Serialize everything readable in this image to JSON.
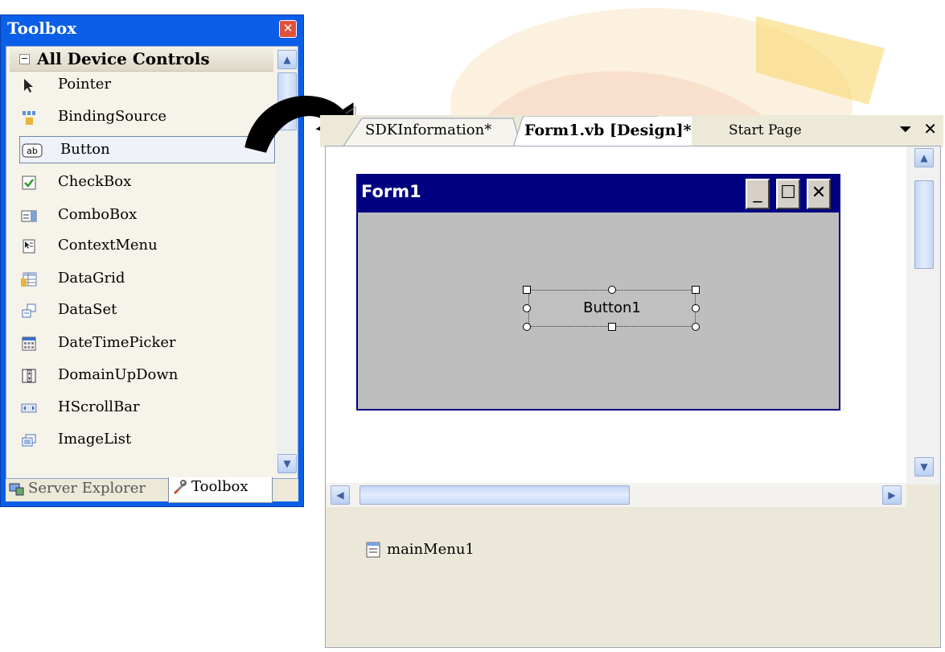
{
  "toolbox": {
    "title": "Toolbox",
    "group_label": "All Device Controls",
    "items": [
      {
        "label": "Pointer",
        "icon": "pointer-icon"
      },
      {
        "label": "BindingSource",
        "icon": "binding-source-icon"
      },
      {
        "label": "Button",
        "icon": "button-icon",
        "selected": true
      },
      {
        "label": "CheckBox",
        "icon": "checkbox-icon"
      },
      {
        "label": "ComboBox",
        "icon": "combobox-icon"
      },
      {
        "label": "ContextMenu",
        "icon": "context-menu-icon"
      },
      {
        "label": "DataGrid",
        "icon": "datagrid-icon"
      },
      {
        "label": "DataSet",
        "icon": "dataset-icon"
      },
      {
        "label": "DateTimePicker",
        "icon": "datetimepicker-icon"
      },
      {
        "label": "DomainUpDown",
        "icon": "domainupdown-icon"
      },
      {
        "label": "HScrollBar",
        "icon": "hscrollbar-icon"
      },
      {
        "label": "ImageList",
        "icon": "imagelist-icon"
      }
    ],
    "bottom_tabs": {
      "server_explorer": "Server Explorer",
      "toolbox": "Toolbox"
    }
  },
  "designer": {
    "tabs": {
      "sdk": "SDKInformation*",
      "form": "Form1.vb [Design]*",
      "start": "Start Page"
    },
    "form": {
      "title": "Form1",
      "button_text": "Button1"
    },
    "tray_component": "mainMenu1"
  },
  "colors": {
    "toolbox_frame": "#0a5ee8",
    "form_titlebar": "#000080",
    "form_background": "#bebebe"
  }
}
